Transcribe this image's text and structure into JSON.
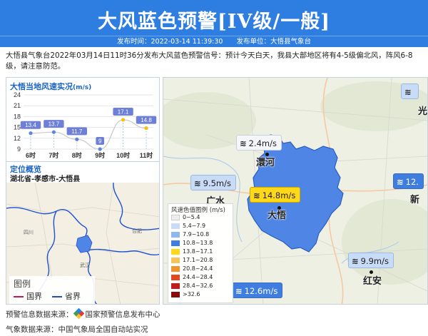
{
  "header": {
    "title": "大风蓝色预警[IV级/一般]",
    "published_time": "发布时间：2022-03-14 11:39:30",
    "publisher": "发布单位：大悟县气象台"
  },
  "description": "大悟县气象台2022年03月14日11时36分发布大风蓝色预警信号：预计今天白天，我县大部地区将有4-5级偏北风，阵风6-8级，请注意防范。",
  "wind_chart": {
    "title": "大悟当地风速实况",
    "unit": "(m/s)",
    "y_ticks": [
      "24",
      "21",
      "18",
      "15",
      "12",
      "9"
    ]
  },
  "chart_data": {
    "type": "line",
    "title": "大悟当地风速实况(m/s)",
    "categories": [
      "6时",
      "7时",
      "8时",
      "9时",
      "10时",
      "11时"
    ],
    "values": [
      13.4,
      13.7,
      11.7,
      9,
      17.1,
      14.8
    ],
    "labels": [
      "13.4",
      "13.7",
      "11.7",
      "9",
      "17.1",
      "14.8"
    ],
    "ylim": [
      9,
      24
    ],
    "grid": true
  },
  "location": {
    "title": "定位概览",
    "path": "湖北省-孝感市-大悟县",
    "legend_title": "图例",
    "legend_items": [
      {
        "label": "国界",
        "color": "#c2185b"
      },
      {
        "label": "省界",
        "color": "#1f4fd6"
      }
    ]
  },
  "mini_map_labels": [
    "四川",
    "合肥",
    "武汉"
  ],
  "main_map": {
    "places": [
      {
        "name": "大悟"
      },
      {
        "name": "澴河"
      },
      {
        "name": "红安"
      },
      {
        "name": "新"
      },
      {
        "name": "光"
      },
      {
        "name": "广水"
      }
    ],
    "wind_labels": [
      {
        "text": "2.4m/s",
        "style": "wl-white"
      },
      {
        "text": "14.8m/s",
        "style": "wl-yellow"
      },
      {
        "text": "9.5m/s",
        "style": "wl-blue"
      },
      {
        "text": "9.9m/s",
        "style": "wl-blue"
      },
      {
        "text": "12.6m/s",
        "style": "wl-dark"
      },
      {
        "text": "12.",
        "style": "wl-dark"
      },
      {
        "text": "",
        "style": "wl-blue"
      }
    ],
    "wind_icon": "wind-gust-icon",
    "wind_glyph": "≋",
    "color_legend": {
      "title": "风速色值图例 (m/s)",
      "items": [
        {
          "label": "0~5.4",
          "color": "#eeeeee"
        },
        {
          "label": "5.4~7.9",
          "color": "#c9dcf7"
        },
        {
          "label": "7.9~10.8",
          "color": "#8fb8ee"
        },
        {
          "label": "10.8~13.8",
          "color": "#3f7ee0"
        },
        {
          "label": "13.8~17.1",
          "color": "#ffd81a"
        },
        {
          "label": "17.1~20.8",
          "color": "#f7c25a"
        },
        {
          "label": "20.8~24.4",
          "color": "#f0952e"
        },
        {
          "label": "24.4~28.4",
          "color": "#e2491e"
        },
        {
          "label": "28.4~32.6",
          "color": "#c31b1b"
        },
        {
          "label": ">32.6",
          "color": "#8a0b0b"
        }
      ]
    }
  },
  "footer": {
    "warning_source_label": "预警信息数据来源：",
    "warning_source": "国家预警信息发布中心",
    "weather_source": "气象数据来源：中国气象局全国自动站实况"
  },
  "colors": {
    "header_bg": "#2e7de1",
    "county_fill": "#4f86e6",
    "province_border": "#1f4fd6",
    "country_border": "#c2185b"
  }
}
